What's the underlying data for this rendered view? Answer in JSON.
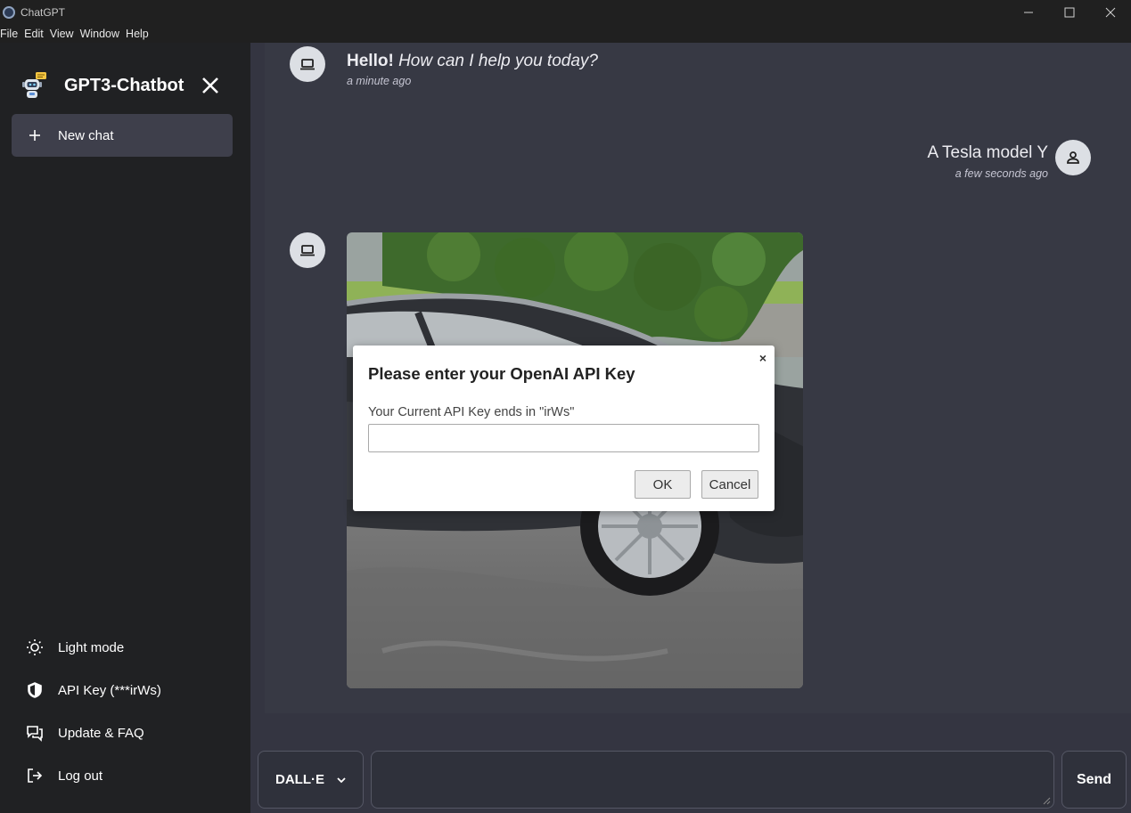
{
  "window": {
    "title": "ChatGPT",
    "menu": [
      "File",
      "Edit",
      "View",
      "Window",
      "Help"
    ]
  },
  "sidebar": {
    "brand": "GPT3-Chatbot",
    "new_chat": "New chat",
    "items": [
      {
        "label": "Light mode",
        "icon": "sun-icon"
      },
      {
        "label": "API Key (***irWs)",
        "icon": "shield-icon"
      },
      {
        "label": "Update & FAQ",
        "icon": "chat-bubbles-icon"
      },
      {
        "label": "Log out",
        "icon": "logout-icon"
      }
    ]
  },
  "chat": {
    "messages": [
      {
        "role": "bot",
        "greeting": "Hello!",
        "text": "How can I help you today?",
        "time": "a minute ago"
      },
      {
        "role": "user",
        "text": "A Tesla model Y",
        "time": "a few seconds ago"
      },
      {
        "role": "bot",
        "type": "image"
      }
    ]
  },
  "composer": {
    "mode": "DALL·E",
    "send": "Send"
  },
  "dialog": {
    "title": "Please enter your OpenAI API Key",
    "label": "Your Current API Key ends in \"irWs\"",
    "ok": "OK",
    "cancel": "Cancel",
    "close": "×"
  }
}
